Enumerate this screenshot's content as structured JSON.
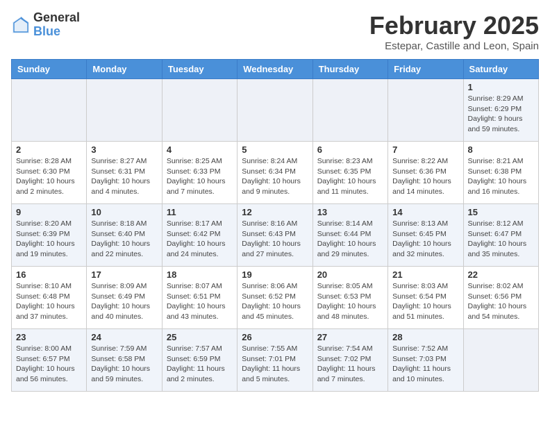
{
  "logo": {
    "general": "General",
    "blue": "Blue"
  },
  "title": {
    "month_year": "February 2025",
    "location": "Estepar, Castille and Leon, Spain"
  },
  "headers": [
    "Sunday",
    "Monday",
    "Tuesday",
    "Wednesday",
    "Thursday",
    "Friday",
    "Saturday"
  ],
  "weeks": [
    [
      {
        "day": "",
        "info": ""
      },
      {
        "day": "",
        "info": ""
      },
      {
        "day": "",
        "info": ""
      },
      {
        "day": "",
        "info": ""
      },
      {
        "day": "",
        "info": ""
      },
      {
        "day": "",
        "info": ""
      },
      {
        "day": "1",
        "info": "Sunrise: 8:29 AM\nSunset: 6:29 PM\nDaylight: 9 hours and 59 minutes."
      }
    ],
    [
      {
        "day": "2",
        "info": "Sunrise: 8:28 AM\nSunset: 6:30 PM\nDaylight: 10 hours and 2 minutes."
      },
      {
        "day": "3",
        "info": "Sunrise: 8:27 AM\nSunset: 6:31 PM\nDaylight: 10 hours and 4 minutes."
      },
      {
        "day": "4",
        "info": "Sunrise: 8:25 AM\nSunset: 6:33 PM\nDaylight: 10 hours and 7 minutes."
      },
      {
        "day": "5",
        "info": "Sunrise: 8:24 AM\nSunset: 6:34 PM\nDaylight: 10 hours and 9 minutes."
      },
      {
        "day": "6",
        "info": "Sunrise: 8:23 AM\nSunset: 6:35 PM\nDaylight: 10 hours and 11 minutes."
      },
      {
        "day": "7",
        "info": "Sunrise: 8:22 AM\nSunset: 6:36 PM\nDaylight: 10 hours and 14 minutes."
      },
      {
        "day": "8",
        "info": "Sunrise: 8:21 AM\nSunset: 6:38 PM\nDaylight: 10 hours and 16 minutes."
      }
    ],
    [
      {
        "day": "9",
        "info": "Sunrise: 8:20 AM\nSunset: 6:39 PM\nDaylight: 10 hours and 19 minutes."
      },
      {
        "day": "10",
        "info": "Sunrise: 8:18 AM\nSunset: 6:40 PM\nDaylight: 10 hours and 22 minutes."
      },
      {
        "day": "11",
        "info": "Sunrise: 8:17 AM\nSunset: 6:42 PM\nDaylight: 10 hours and 24 minutes."
      },
      {
        "day": "12",
        "info": "Sunrise: 8:16 AM\nSunset: 6:43 PM\nDaylight: 10 hours and 27 minutes."
      },
      {
        "day": "13",
        "info": "Sunrise: 8:14 AM\nSunset: 6:44 PM\nDaylight: 10 hours and 29 minutes."
      },
      {
        "day": "14",
        "info": "Sunrise: 8:13 AM\nSunset: 6:45 PM\nDaylight: 10 hours and 32 minutes."
      },
      {
        "day": "15",
        "info": "Sunrise: 8:12 AM\nSunset: 6:47 PM\nDaylight: 10 hours and 35 minutes."
      }
    ],
    [
      {
        "day": "16",
        "info": "Sunrise: 8:10 AM\nSunset: 6:48 PM\nDaylight: 10 hours and 37 minutes."
      },
      {
        "day": "17",
        "info": "Sunrise: 8:09 AM\nSunset: 6:49 PM\nDaylight: 10 hours and 40 minutes."
      },
      {
        "day": "18",
        "info": "Sunrise: 8:07 AM\nSunset: 6:51 PM\nDaylight: 10 hours and 43 minutes."
      },
      {
        "day": "19",
        "info": "Sunrise: 8:06 AM\nSunset: 6:52 PM\nDaylight: 10 hours and 45 minutes."
      },
      {
        "day": "20",
        "info": "Sunrise: 8:05 AM\nSunset: 6:53 PM\nDaylight: 10 hours and 48 minutes."
      },
      {
        "day": "21",
        "info": "Sunrise: 8:03 AM\nSunset: 6:54 PM\nDaylight: 10 hours and 51 minutes."
      },
      {
        "day": "22",
        "info": "Sunrise: 8:02 AM\nSunset: 6:56 PM\nDaylight: 10 hours and 54 minutes."
      }
    ],
    [
      {
        "day": "23",
        "info": "Sunrise: 8:00 AM\nSunset: 6:57 PM\nDaylight: 10 hours and 56 minutes."
      },
      {
        "day": "24",
        "info": "Sunrise: 7:59 AM\nSunset: 6:58 PM\nDaylight: 10 hours and 59 minutes."
      },
      {
        "day": "25",
        "info": "Sunrise: 7:57 AM\nSunset: 6:59 PM\nDaylight: 11 hours and 2 minutes."
      },
      {
        "day": "26",
        "info": "Sunrise: 7:55 AM\nSunset: 7:01 PM\nDaylight: 11 hours and 5 minutes."
      },
      {
        "day": "27",
        "info": "Sunrise: 7:54 AM\nSunset: 7:02 PM\nDaylight: 11 hours and 7 minutes."
      },
      {
        "day": "28",
        "info": "Sunrise: 7:52 AM\nSunset: 7:03 PM\nDaylight: 11 hours and 10 minutes."
      },
      {
        "day": "",
        "info": ""
      }
    ]
  ]
}
